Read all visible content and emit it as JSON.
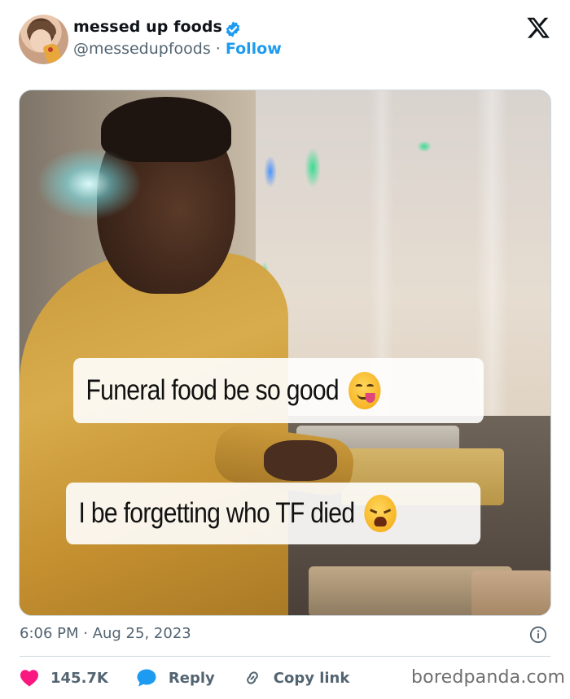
{
  "tweet": {
    "author_name": "messed up foods",
    "handle": "@messedupfoods",
    "separator": "·",
    "follow_label": "Follow",
    "timestamp": "6:06 PM · Aug 25, 2023",
    "caption_line1": "Funeral food be so good",
    "caption_line2": "I be forgetting who TF died"
  },
  "actions": {
    "like_count": "145.7K",
    "reply_label": "Reply",
    "copy_link_label": "Copy link"
  },
  "icons": {
    "verified": "verified-badge-icon",
    "x_logo": "x-logo-icon",
    "info": "info-icon",
    "like": "heart-icon",
    "reply": "chat-bubble-icon",
    "copy_link": "link-icon"
  },
  "colors": {
    "accent": "#1d9bf0",
    "like": "#f91880",
    "muted": "#536471"
  },
  "watermark": "boredpanda.com"
}
